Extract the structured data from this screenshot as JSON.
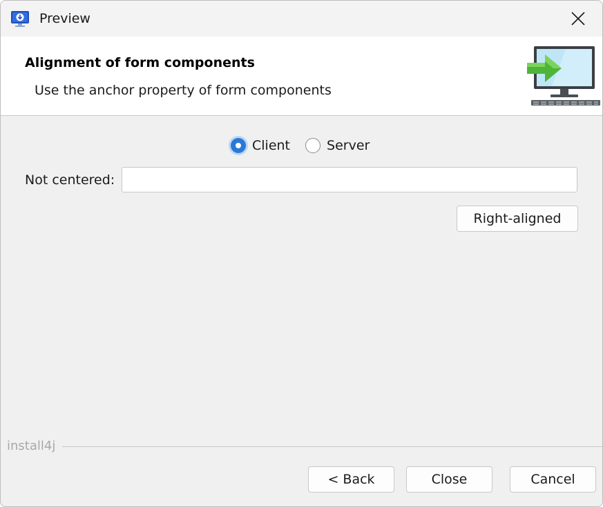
{
  "window": {
    "title": "Preview",
    "app_icon": "installer-download-icon",
    "close_icon": "close-icon"
  },
  "header": {
    "title": "Alignment of form components",
    "subtitle": "Use the anchor property of form components",
    "graphic": "monitor-arrow-icon"
  },
  "form": {
    "radios": [
      {
        "label": "Client",
        "checked": true
      },
      {
        "label": "Server",
        "checked": false
      }
    ],
    "field_label": "Not centered:",
    "field_value": "",
    "field_placeholder": "",
    "right_button_label": "Right-aligned"
  },
  "footer": {
    "brand": "install4j",
    "back_label": "< Back",
    "close_label": "Close",
    "cancel_label": "Cancel"
  },
  "colors": {
    "accent": "#2a78d8",
    "window_bg": "#f0f0f0",
    "header_bg": "#ffffff"
  }
}
